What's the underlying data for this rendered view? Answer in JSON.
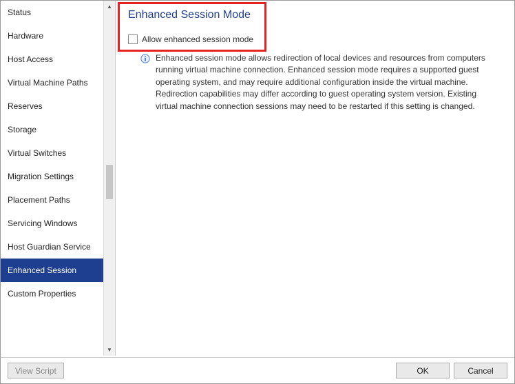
{
  "sidebar": {
    "items": [
      {
        "label": "Status"
      },
      {
        "label": "Hardware"
      },
      {
        "label": "Host Access"
      },
      {
        "label": "Virtual Machine Paths"
      },
      {
        "label": "Reserves"
      },
      {
        "label": "Storage"
      },
      {
        "label": "Virtual Switches"
      },
      {
        "label": "Migration Settings"
      },
      {
        "label": "Placement Paths"
      },
      {
        "label": "Servicing Windows"
      },
      {
        "label": "Host Guardian Service"
      },
      {
        "label": "Enhanced Session"
      },
      {
        "label": "Custom Properties"
      }
    ],
    "selected_index": 11
  },
  "content": {
    "title": "Enhanced Session Mode",
    "checkbox_label": "Allow enhanced session mode",
    "checkbox_checked": false,
    "info_text": "Enhanced session mode allows redirection of local devices and resources from computers running virtual machine connection. Enhanced session mode requires a supported guest operating system, and may require additional configuration inside the virtual machine. Redirection capabilities may differ according to guest operating system version. Existing virtual machine connection sessions may need to be restarted if this setting is changed."
  },
  "footer": {
    "view_script": "View Script",
    "ok": "OK",
    "cancel": "Cancel"
  }
}
